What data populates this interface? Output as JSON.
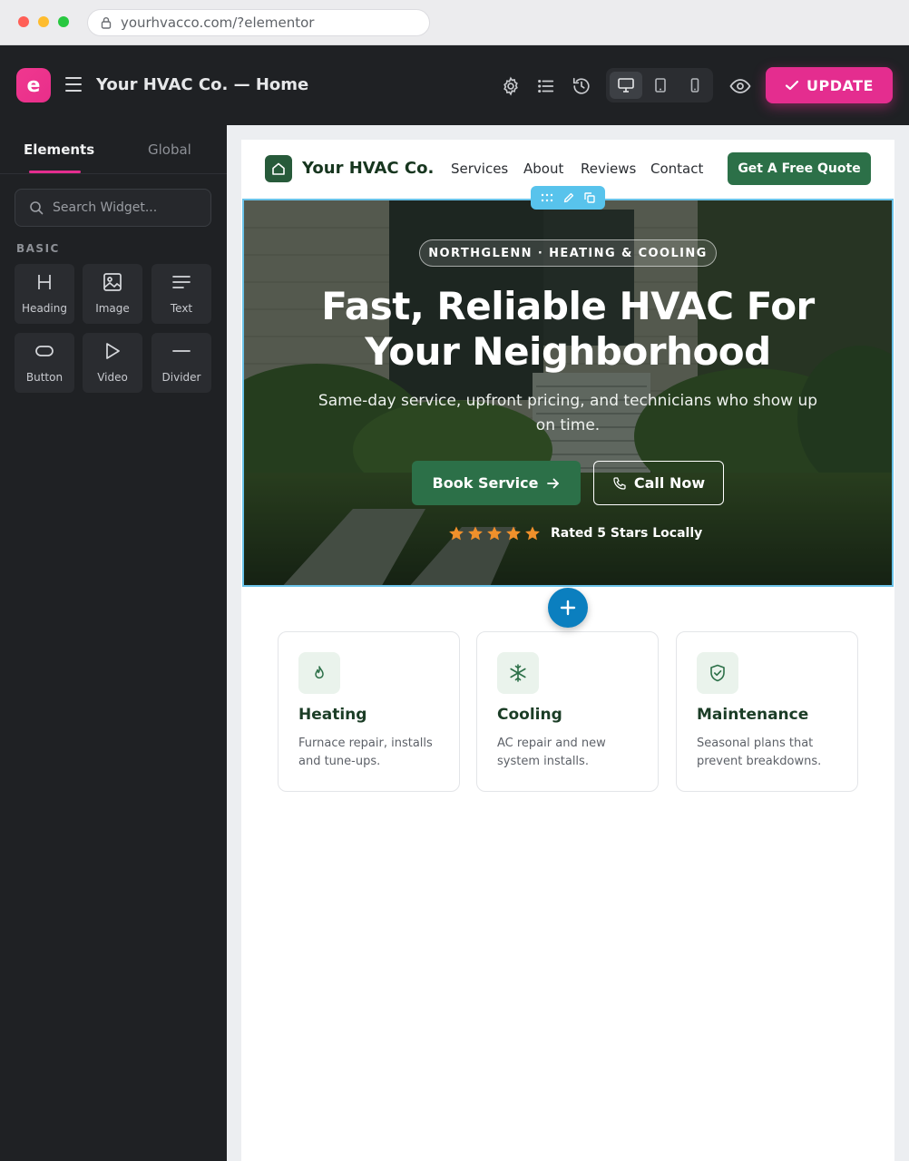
{
  "browser": {
    "url": "yourhvacco.com/?elementor"
  },
  "editor": {
    "logo_letter": "e",
    "document_title": "Your HVAC Co. — Home",
    "update_label": "UPDATE"
  },
  "sidebar": {
    "tabs": [
      {
        "label": "Elements"
      },
      {
        "label": "Global"
      }
    ],
    "search_placeholder": "Search Widget...",
    "section_label": "BASIC",
    "widgets": [
      {
        "label": "Heading",
        "icon": "heading-icon"
      },
      {
        "label": "Image",
        "icon": "image-icon"
      },
      {
        "label": "Text",
        "icon": "text-icon"
      },
      {
        "label": "Button",
        "icon": "button-icon"
      },
      {
        "label": "Video",
        "icon": "video-icon"
      },
      {
        "label": "Divider",
        "icon": "divider-icon"
      }
    ]
  },
  "site": {
    "name": "Your HVAC Co.",
    "nav": [
      "Services",
      "About",
      "Reviews",
      "Contact"
    ],
    "cta": "Get A Free Quote"
  },
  "hero": {
    "eyebrow": "NORTHGLENN · HEATING & COOLING",
    "title": "Fast, Reliable HVAC For Your Neighborhood",
    "subtitle": "Same-day service, upfront pricing, and technicians who show up on time.",
    "primary_button": "Book Service",
    "secondary_button": "Call Now",
    "rating": 5,
    "rating_text": "Rated 5 Stars Locally"
  },
  "services": [
    {
      "title": "Heating",
      "description": "Furnace repair, installs and tune-ups.",
      "icon": "flame-icon"
    },
    {
      "title": "Cooling",
      "description": "AC repair and new system installs.",
      "icon": "snowflake-icon"
    },
    {
      "title": "Maintenance",
      "description": "Seasonal plans that prevent breakdowns.",
      "icon": "shield-check-icon"
    }
  ],
  "colors": {
    "elementor_pink": "#e42d8f",
    "brand_green": "#2c7048",
    "star_orange": "#f0902b",
    "selection_blue": "#58c3ec"
  }
}
